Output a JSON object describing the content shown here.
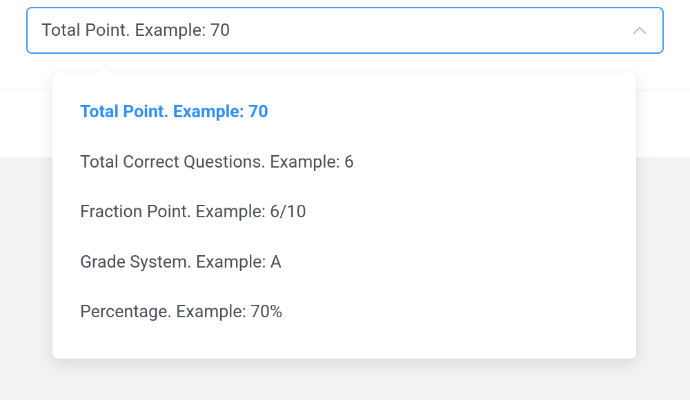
{
  "select": {
    "value": "Total Point. Example: 70",
    "options": [
      {
        "label": "Total Point. Example: 70",
        "selected": true
      },
      {
        "label": "Total Correct Questions. Example: 6",
        "selected": false
      },
      {
        "label": "Fraction Point. Example: 6/10",
        "selected": false
      },
      {
        "label": "Grade System. Example: A",
        "selected": false
      },
      {
        "label": "Percentage. Example: 70%",
        "selected": false
      }
    ]
  },
  "colors": {
    "accent": "#2e90ff",
    "border_focus": "#3f9bff",
    "text": "#4a4f57",
    "bg": "#f1f2f3"
  }
}
